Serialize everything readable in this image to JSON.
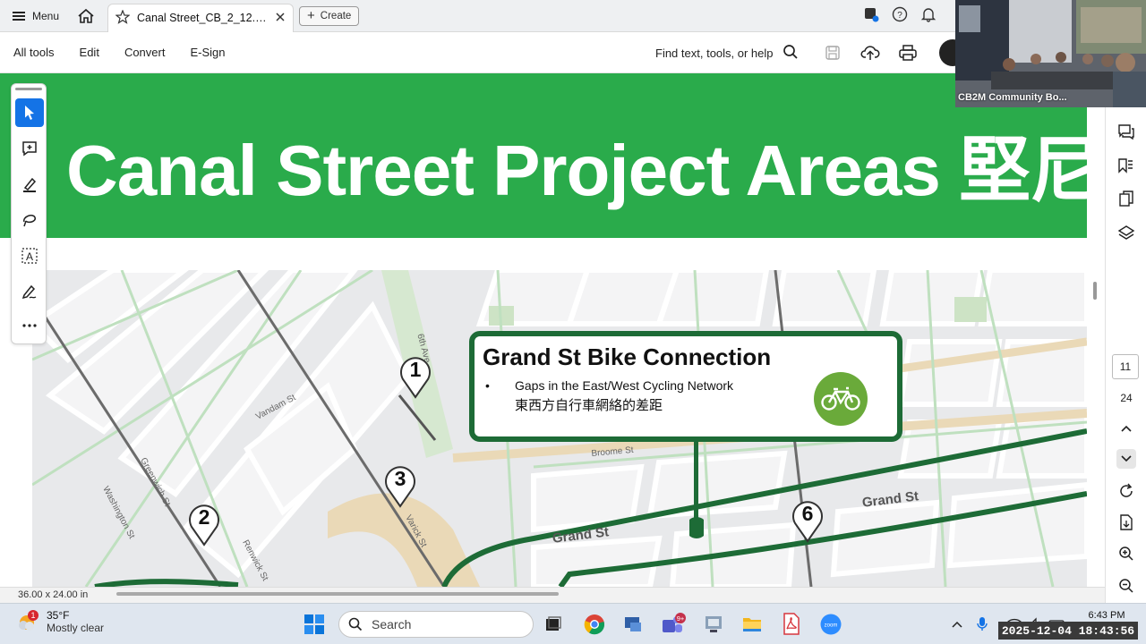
{
  "tabbar": {
    "menu_label": "Menu",
    "tab_title": "Canal Street_CB_2_12.0...",
    "create_label": "Create"
  },
  "toolbar": {
    "items": [
      "All tools",
      "Edit",
      "Convert",
      "E-Sign"
    ],
    "find_label": "Find text, tools, or help"
  },
  "document": {
    "banner_title": "Canal Street Project Areas 堅尼街",
    "callout": {
      "title": "Grand St Bike Connection",
      "bullet": "•",
      "line_en": "Gaps in the East/West Cycling Network",
      "line_zh": "東西方自行車網絡的差距"
    },
    "pins": [
      "1",
      "2",
      "3",
      "6"
    ],
    "streets": {
      "sixth_ave": "6th Ave",
      "vandam": "Vandam St",
      "greenwich": "Greenwich St",
      "washington": "Washington St",
      "varick": "Varick St",
      "renwick": "Renwick St",
      "broome": "Broome St",
      "grand_left": "Grand St",
      "grand_right": "Grand St"
    },
    "page_size": "36.00 x 24.00 in"
  },
  "right_rail": {
    "current_page": "11",
    "total_pages": "24"
  },
  "video": {
    "label": "CB2M Community Bo..."
  },
  "taskbar": {
    "weather_badge": "1",
    "temperature": "35°F",
    "weather_desc": "Mostly clear",
    "search_label": "Search",
    "teams_badge": "9+",
    "time": "6:43 PM",
    "datestamp": "2025-12-04  18:43:56"
  },
  "colors": {
    "banner_green": "#2aab4b",
    "route_green": "#1d6b36",
    "bike_badge": "#6aaa3a",
    "accent_blue": "#1473e6"
  }
}
